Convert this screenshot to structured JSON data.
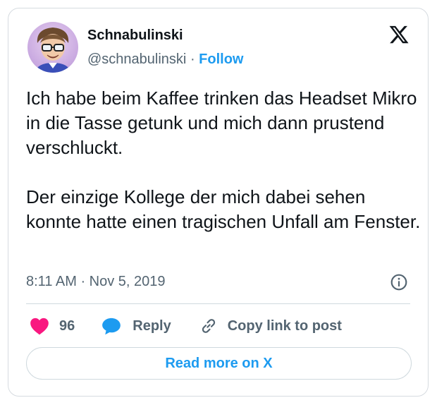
{
  "author": {
    "name": "Schnabulinski",
    "handle": "@schnabulinski",
    "separator": "·",
    "follow_label": "Follow",
    "avatar_icon": "profile-photo"
  },
  "tweet": {
    "paragraphs": [
      "Ich habe beim Kaffee trinken das Headset Mikro in die Tasse getunk und mich dann prustend verschluckt.",
      "Der einzige Kollege der mich dabei sehen konnte hatte einen tragischen Unfall am Fenster."
    ],
    "timestamp": "8:11 AM · Nov 5, 2019"
  },
  "actions": {
    "like_count": "96",
    "reply_label": "Reply",
    "copy_label": "Copy link to post"
  },
  "footer": {
    "read_more_label": "Read more on X"
  },
  "icons": {
    "brand": "x-logo-icon",
    "info": "info-icon",
    "like": "heart-icon",
    "reply": "speech-bubble-icon",
    "copy": "link-icon"
  },
  "colors": {
    "accent": "#1d9bf0",
    "like": "#f91880",
    "text": "#0f1419",
    "muted": "#536471",
    "border": "#cfd9de"
  }
}
